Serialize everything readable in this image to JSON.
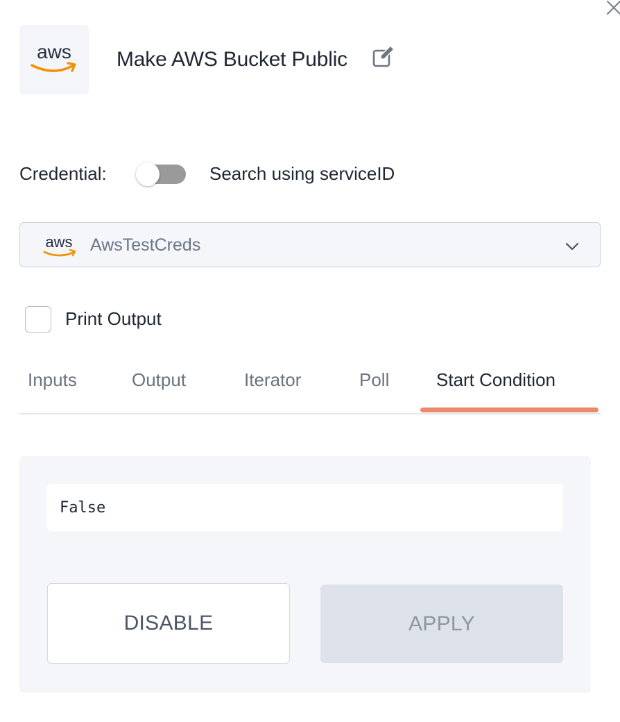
{
  "header": {
    "logo_text": "aws",
    "title": "Make AWS Bucket Public",
    "edit_icon": "edit-icon",
    "close_icon": "close-icon"
  },
  "credential": {
    "label": "Credential:",
    "toggle_label": "Search using serviceID",
    "toggle_on": false
  },
  "credential_select": {
    "logo_text": "aws",
    "value": "AwsTestCreds",
    "chevron_icon": "chevron-down-icon"
  },
  "print_output": {
    "label": "Print Output",
    "checked": false
  },
  "tabs": [
    {
      "label": "Inputs",
      "active": false
    },
    {
      "label": "Output",
      "active": false
    },
    {
      "label": "Iterator",
      "active": false
    },
    {
      "label": "Poll",
      "active": false
    },
    {
      "label": "Start Condition",
      "active": true
    }
  ],
  "start_condition": {
    "value": "False",
    "disable_label": "DISABLE",
    "apply_label": "APPLY"
  },
  "colors": {
    "accent": "#e98a6f",
    "aws_orange": "#f29100",
    "aws_text": "#252f3e"
  }
}
